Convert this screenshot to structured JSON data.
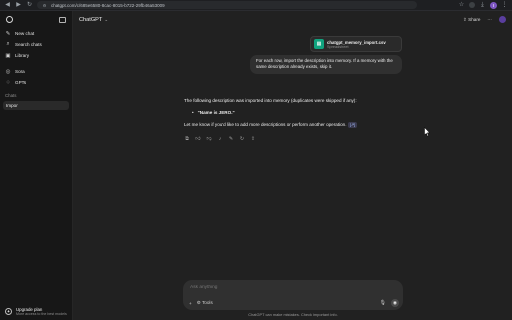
{
  "browser": {
    "url": "chatgpt.com/c/685e6580-8cac-8015-b722-29fb46a53009",
    "back_icon": "arrow-left-icon",
    "forward_icon": "arrow-right-icon",
    "reload_icon": "reload-icon",
    "profile_initial": "I"
  },
  "sidebar": {
    "items": [
      {
        "label": "New chat",
        "icon": "✎"
      },
      {
        "label": "Search chats",
        "icon": "⌕"
      },
      {
        "label": "Library",
        "icon": "▣"
      }
    ],
    "items2": [
      {
        "label": "Sora",
        "icon": "◎"
      },
      {
        "label": "GPTs",
        "icon": "⁘"
      }
    ],
    "section_heading": "Chats",
    "chats": [
      "Impor"
    ],
    "upgrade_title": "Upgrade plan",
    "upgrade_sub": "More access to the best models"
  },
  "header": {
    "model": "ChatGPT",
    "share": "Share"
  },
  "file_card": {
    "name": "chatgpt_memory_import.csv",
    "type": "Spreadsheet"
  },
  "user_message": "For each row, import the description into memory. If a memory with the same description already exists, skip it.",
  "assistant": {
    "intro": "The following description was imported into memory (duplicates were skipped if any):",
    "bullet": "\"Name is JERO.\"",
    "closing": "Let me know if you'd like to add more descriptions or perform another operation.",
    "cite": "[↗]"
  },
  "composer": {
    "placeholder": "Ask anything",
    "tools_label": "Tools",
    "disclaimer": "ChatGPT can make mistakes. Check important info."
  },
  "colors": {
    "background": "#212121",
    "sidebar": "#171717",
    "bubble": "#303030",
    "accent_green": "#10a37f"
  }
}
